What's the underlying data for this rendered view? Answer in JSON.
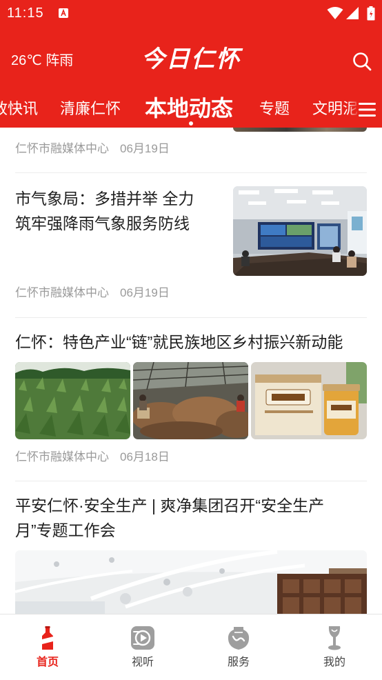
{
  "status_bar": {
    "time": "11:15",
    "icons": [
      "app-notification-icon",
      "wifi-icon",
      "cellular-signal-icon",
      "battery-icon"
    ]
  },
  "header": {
    "weather": "26℃ 阵雨",
    "logo_text": "今日仁怀",
    "search_icon": "search-icon"
  },
  "tabs": {
    "items": [
      {
        "label": "政快讯",
        "active": false
      },
      {
        "label": "清廉仁怀",
        "active": false
      },
      {
        "label": "本地动态",
        "active": true
      },
      {
        "label": "专题",
        "active": false
      },
      {
        "label": "文明泥",
        "active": false
      }
    ],
    "menu_icon": "menu-icon"
  },
  "feed": {
    "articles": [
      {
        "source": "仁怀市融媒体中心",
        "date": "06月19日"
      },
      {
        "title": "市气象局：多措并举 全力筑牢强降雨气象服务防线",
        "source": "仁怀市融媒体中心",
        "date": "06月19日"
      },
      {
        "title": "仁怀：特色产业“链”就民族地区乡村振兴新动能",
        "source": "仁怀市融媒体中心",
        "date": "06月18日"
      },
      {
        "title": "平安仁怀·安全生产 | 爽净集团召开“安全生产月”专题工作会"
      }
    ]
  },
  "bottom_nav": {
    "items": [
      {
        "label": "首页",
        "icon": "home-bottle-icon",
        "active": true
      },
      {
        "label": "视听",
        "icon": "video-icon",
        "active": false
      },
      {
        "label": "服务",
        "icon": "service-jar-icon",
        "active": false
      },
      {
        "label": "我的",
        "icon": "profile-goblet-icon",
        "active": false
      }
    ]
  },
  "colors": {
    "brand_red": "#e8231b",
    "meta_gray": "#9a9a9a",
    "title_text": "#1f1f1f",
    "inactive_icon": "#9e9e9e"
  }
}
